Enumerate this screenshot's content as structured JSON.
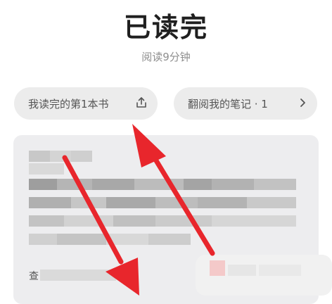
{
  "header": {
    "title": "已读完",
    "subtitle": "阅读9分钟"
  },
  "actions": {
    "finished_book_label": "我读完的第1本书",
    "notes_label": "翻阅我的笔记 · 1"
  },
  "card": {
    "partial_label": "查"
  },
  "icons": {
    "share": "share-upload-icon",
    "chevron": "chevron-right-icon"
  },
  "colors": {
    "annotation_arrow": "#e8262c",
    "pill_background": "#ececec",
    "card_background": "#ededef"
  }
}
